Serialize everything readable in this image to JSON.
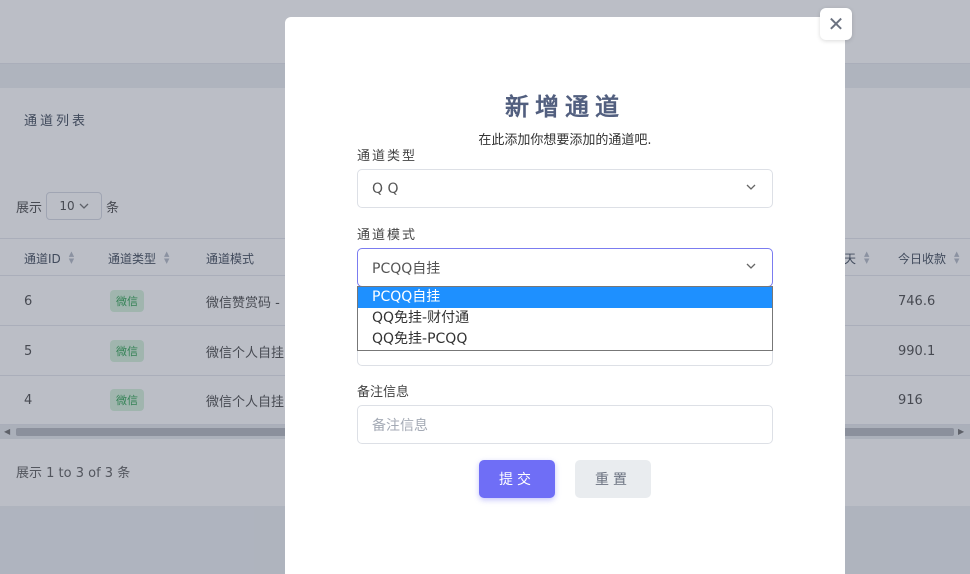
{
  "background": {
    "card_title": "通道列表",
    "length_prefix": "展示",
    "length_value": "10",
    "length_suffix": "条",
    "columns": [
      {
        "label": "通道ID"
      },
      {
        "label": "通道类型"
      },
      {
        "label": "通道模式"
      },
      {
        "label": "天"
      },
      {
        "label": "今日收款"
      }
    ],
    "rows": [
      {
        "id": "6",
        "type": "微信",
        "mode": "微信赞赏码 -",
        "today": "746.6"
      },
      {
        "id": "5",
        "type": "微信",
        "mode": "微信个人自挂",
        "today": "990.1"
      },
      {
        "id": "4",
        "type": "微信",
        "mode": "微信个人自挂",
        "today": "916"
      }
    ],
    "info": "展示 1 to 3 of 3 条"
  },
  "modal": {
    "close_symbol": "✕",
    "title": "新增通道",
    "subtitle": "在此添加你想要添加的通道吧.",
    "channel_type_label": "通道类型",
    "channel_type_value": "Q Q",
    "channel_mode_label": "通道模式",
    "channel_mode_value": "PCQQ自挂",
    "mode_options": [
      "PCQQ自挂",
      "QQ免挂-财付通",
      "QQ免挂-PCQQ"
    ],
    "remark_label": "备注信息",
    "remark_placeholder": "备注信息",
    "submit_label": "提交",
    "reset_label": "重置"
  },
  "icons": {
    "chevron": "chevron-down-icon",
    "sort": "sort-icon",
    "close": "close-icon"
  },
  "colors": {
    "primary": "#6f6ef6",
    "selected_option": "#1e90ff",
    "badge_bg": "#d7f2dc",
    "badge_text": "#3aa85b"
  }
}
